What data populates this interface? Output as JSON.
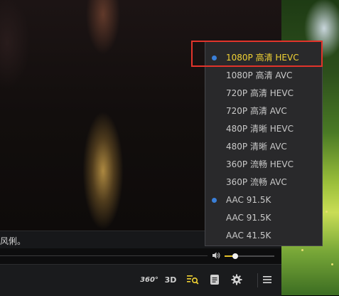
{
  "subtitle": {
    "text": "风俐。"
  },
  "volume": {
    "level_percent": 22
  },
  "toolbar": {
    "label_360": "360°",
    "label_3d": "3D"
  },
  "quality_menu": {
    "items": [
      {
        "label": "1080P 高清 HEVC",
        "selected": true,
        "active": true
      },
      {
        "label": "1080P 高清 AVC",
        "selected": false,
        "active": false
      },
      {
        "label": "720P 高清 HEVC",
        "selected": false,
        "active": false
      },
      {
        "label": "720P 高清 AVC",
        "selected": false,
        "active": false
      },
      {
        "label": "480P 清晰 HEVC",
        "selected": false,
        "active": false
      },
      {
        "label": "480P 清晰 AVC",
        "selected": false,
        "active": false
      },
      {
        "label": "360P 流畅 HEVC",
        "selected": false,
        "active": false
      },
      {
        "label": "360P 流畅 AVC",
        "selected": false,
        "active": false
      },
      {
        "label": "AAC 91.5K",
        "selected": true,
        "active": false
      },
      {
        "label": "AAC 91.5K",
        "selected": false,
        "active": false
      },
      {
        "label": "AAC 41.5K",
        "selected": false,
        "active": false
      }
    ]
  },
  "colors": {
    "accent_yellow": "#f1d234",
    "selected_dot": "#3a7fd8",
    "highlight_box": "#e1342b"
  },
  "icons": {
    "volume": "speaker-icon",
    "quality": "quality-search-icon",
    "playlist": "playlist-icon",
    "settings": "gear-icon",
    "menu": "hamburger-menu-icon"
  }
}
